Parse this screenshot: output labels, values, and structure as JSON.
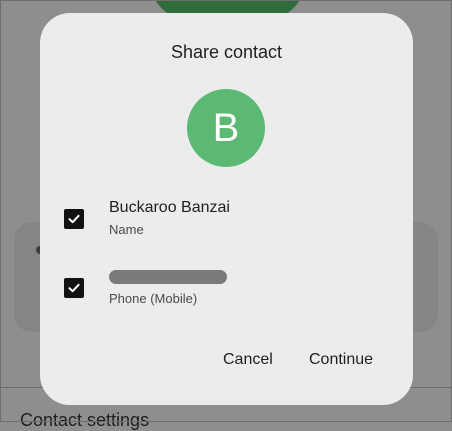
{
  "background": {
    "section_label": "Contact settings"
  },
  "dialog": {
    "title": "Share contact",
    "avatar_letter": "B",
    "avatar_color": "#5bb974",
    "rows": [
      {
        "primary": "Buckaroo Banzai",
        "secondary": "Name",
        "checked": true
      },
      {
        "primary_redacted": true,
        "secondary": "Phone (Mobile)",
        "checked": true
      }
    ],
    "actions": {
      "cancel_label": "Cancel",
      "continue_label": "Continue"
    }
  }
}
